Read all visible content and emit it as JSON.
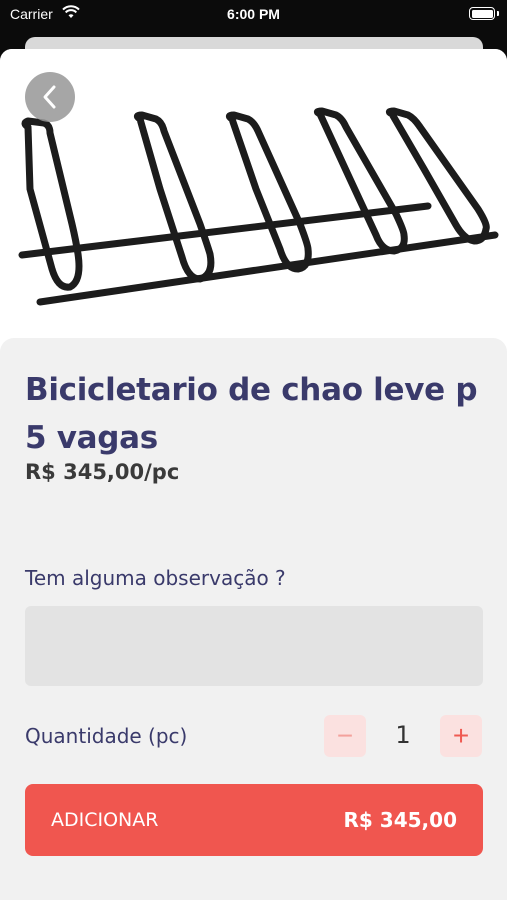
{
  "status_bar": {
    "carrier": "Carrier",
    "time": "6:00 PM"
  },
  "product": {
    "title": "Bicicletario de chao leve p 5 vagas",
    "price": "R$ 345,00/pc",
    "image_icon": "bike-rack-image"
  },
  "observation": {
    "label": "Tem alguma observação ?",
    "value": "",
    "placeholder": ""
  },
  "quantity": {
    "label": "Quantidade (pc)",
    "value": "1",
    "minus": "−",
    "plus": "+"
  },
  "add_button": {
    "label": "ADICIONAR",
    "total": "R$ 345,00"
  },
  "colors": {
    "accent": "#f0564f",
    "title": "#3a3a6b",
    "qty_button_bg": "#fbe1e0"
  }
}
